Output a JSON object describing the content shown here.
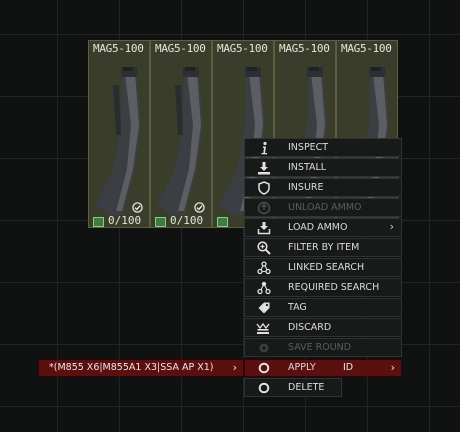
{
  "items": [
    {
      "title": "MAG5-100",
      "ammo": "0/100"
    },
    {
      "title": "MAG5-100",
      "ammo": "0/100"
    },
    {
      "title": "MAG5-100",
      "ammo": ""
    },
    {
      "title": "MAG5-100",
      "ammo": ""
    },
    {
      "title": "MAG5-100",
      "ammo": ""
    }
  ],
  "context_menu": {
    "items": [
      {
        "label": "INSPECT",
        "icon": "info-icon",
        "disabled": false
      },
      {
        "label": "INSTALL",
        "icon": "install-icon",
        "disabled": false
      },
      {
        "label": "INSURE",
        "icon": "shield-icon",
        "disabled": false
      },
      {
        "label": "UNLOAD AMMO",
        "icon": "unload-icon",
        "disabled": true
      },
      {
        "label": "LOAD AMMO",
        "icon": "load-ammo-icon",
        "disabled": false,
        "has_submenu": true
      },
      {
        "label": "FILTER BY ITEM",
        "icon": "filter-icon",
        "disabled": false
      },
      {
        "label": "LINKED SEARCH",
        "icon": "linked-search-icon",
        "disabled": false
      },
      {
        "label": "REQUIRED SEARCH",
        "icon": "required-search-icon",
        "disabled": false
      },
      {
        "label": "TAG",
        "icon": "tag-icon",
        "disabled": false
      },
      {
        "label": "DISCARD",
        "icon": "discard-icon",
        "disabled": false
      },
      {
        "label": "SAVE ROUND",
        "icon": "save-icon",
        "disabled": true
      }
    ],
    "preset_submenu": {
      "label": "*(M855 X6|M855A1 X3|SSA AP X1)",
      "tail_label": "ID"
    },
    "apply_menu": {
      "apply_label": "APPLY",
      "delete_label": "DELETE"
    }
  },
  "colors": {
    "slot_bg": "#3a3d2a",
    "menu_bg": "#181a1a",
    "highlight_red": "#5c0f0f",
    "text": "#dcdcdc",
    "disabled_text": "#5b5e5e"
  }
}
